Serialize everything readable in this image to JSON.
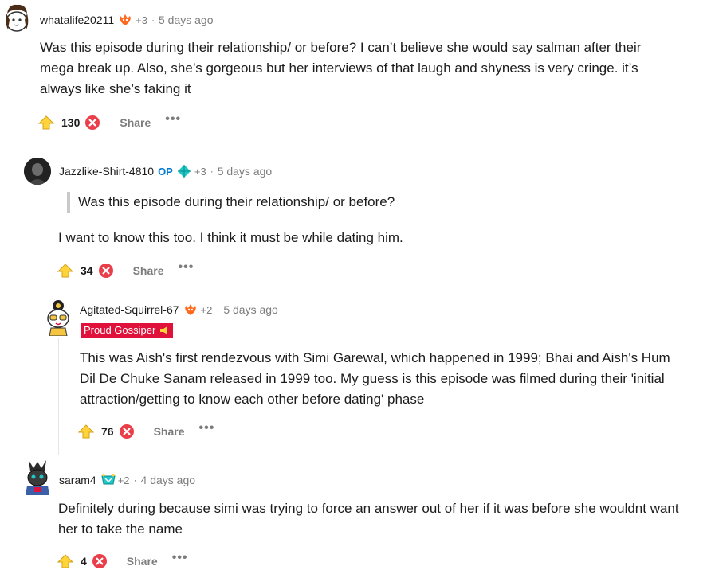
{
  "comments": [
    {
      "username": "whatalife20211",
      "awards": "+3",
      "time": "5 days ago",
      "body": "Was this episode during their relationship/ or before? I can’t believe she would say salman after their mega break up. Also, she’s gorgeous but her interviews of that laugh and shyness is very cringe. it’s always like she’s faking it",
      "score": "130",
      "share": "Share",
      "more": "•••"
    },
    {
      "username": "Jazzlike-Shirt-4810",
      "op_badge": "OP",
      "awards": "+3",
      "time": "5 days ago",
      "quote": "Was this episode during their relationship/ or before?",
      "body": "I want to know this too. I think it must be while dating him.",
      "score": "34",
      "share": "Share",
      "more": "•••"
    },
    {
      "username": "Agitated-Squirrel-67",
      "awards": "+2",
      "time": "5 days ago",
      "flair": "Proud Gossiper",
      "body": "This was Aish's first rendezvous with Simi Garewal, which happened in 1999; Bhai and Aish's Hum Dil De Chuke Sanam released in 1999 too. My guess is this episode was filmed during their 'initial attraction/getting to know each other before dating' phase",
      "score": "76",
      "share": "Share",
      "more": "•••"
    },
    {
      "username": "saram4",
      "awards": "+2",
      "time": "4 days ago",
      "body": "Definitely during because simi was trying to force an answer out of her if it was before she wouldnt want her to take the name",
      "score": "4",
      "share": "Share",
      "more": "•••"
    }
  ],
  "colors": {
    "upvote": "#ffb000",
    "downvote": "#ea3f4a",
    "flair_bg": "#e0113a",
    "op": "#0079d3",
    "meta": "#7c7c7c"
  },
  "icons": [
    "avatar",
    "award-icon",
    "upvote-icon",
    "downvote-icon",
    "more-options-icon"
  ]
}
